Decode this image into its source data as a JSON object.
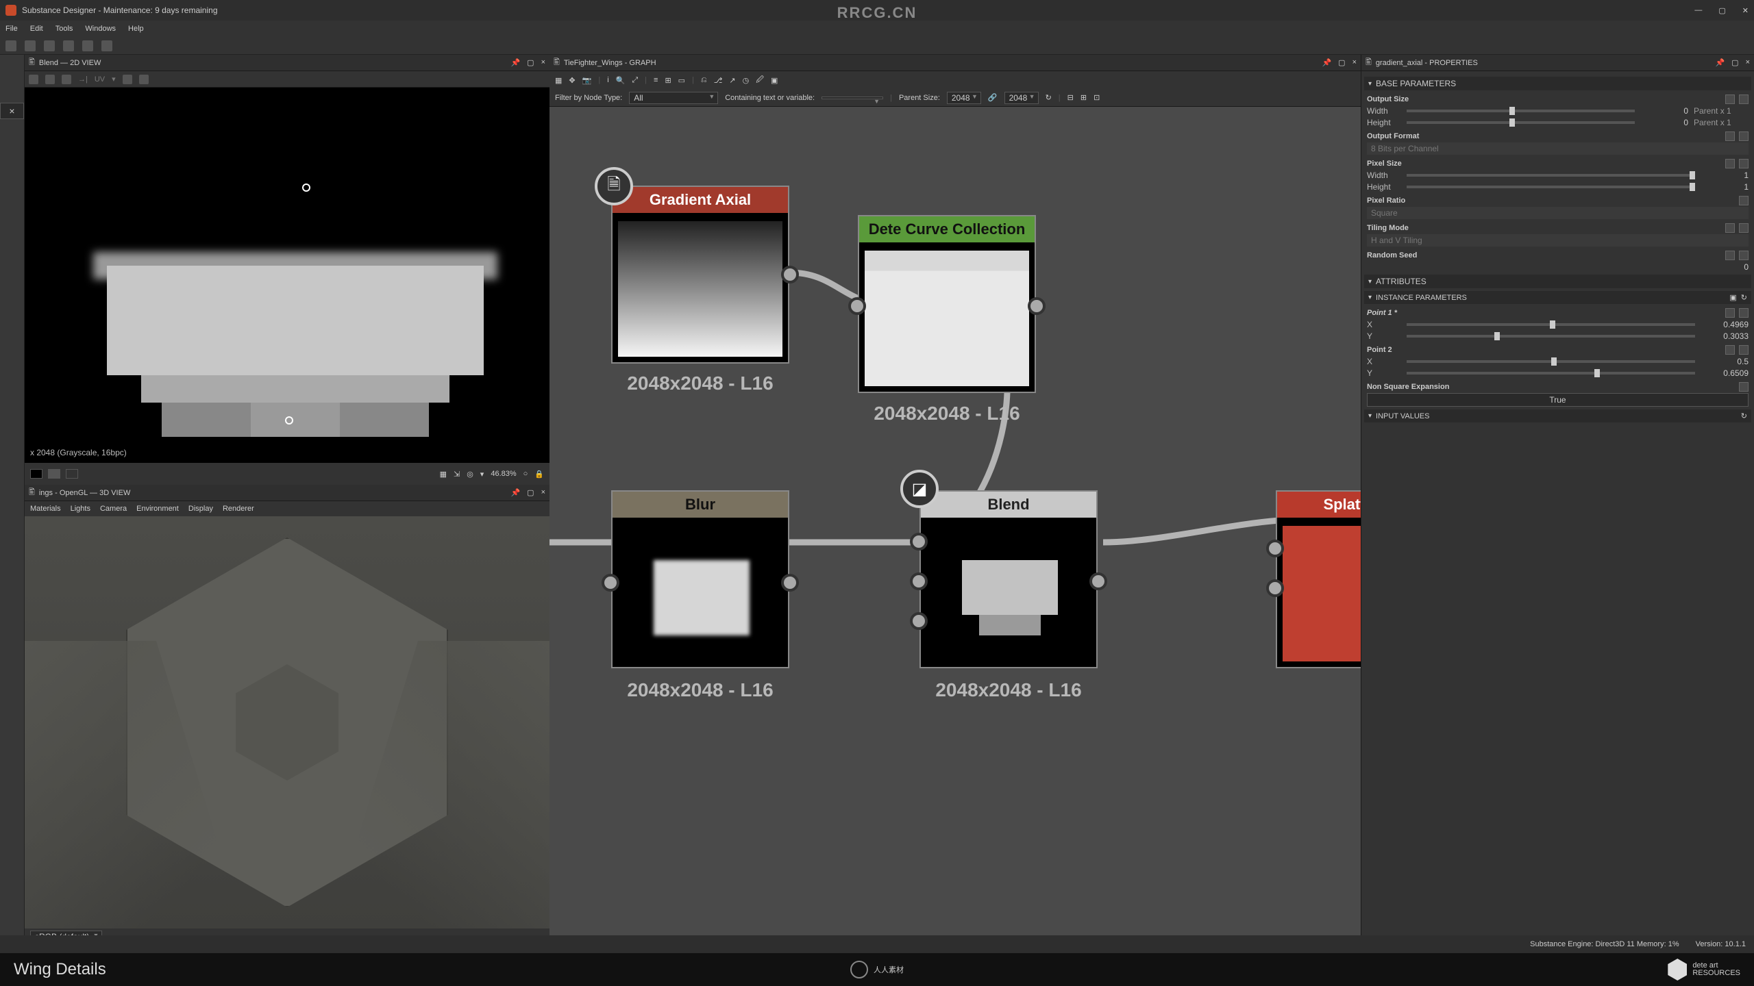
{
  "app": {
    "title": "Substance Designer - Maintenance: 9 days remaining",
    "menu": [
      "File",
      "Edit",
      "Tools",
      "Windows",
      "Help"
    ]
  },
  "center_watermark": "RRCG.CN",
  "panel2d": {
    "title": "Blend — 2D VIEW",
    "status": "x 2048 (Grayscale, 16bpc)",
    "zoom": "46.83%"
  },
  "panel3d": {
    "title": "ings - OpenGL — 3D VIEW",
    "menu": [
      "Materials",
      "Lights",
      "Camera",
      "Environment",
      "Display",
      "Renderer"
    ],
    "colorspace": "sRGB (default)"
  },
  "graph": {
    "title": "TieFighter_Wings - GRAPH",
    "filterLabel": "Filter by Node Type:",
    "filterValue": "All",
    "containLabel": "Containing text or variable:",
    "parentSizeLabel": "Parent Size:",
    "parentSize1": "2048",
    "parentSize2": "2048",
    "nodes": {
      "gradient": {
        "label": "Gradient Axial",
        "res": "2048x2048 - L16"
      },
      "curve": {
        "label": "Dete Curve Collection",
        "res": "2048x2048 - L16"
      },
      "blur": {
        "label": "Blur",
        "res": "2048x2048 - L16"
      },
      "blend": {
        "label": "Blend",
        "res": "2048x2048 - L16"
      },
      "splatt": {
        "label": "Splatt"
      }
    }
  },
  "props": {
    "title": "gradient_axial - PROPERTIES",
    "sections": {
      "base": "BASE PARAMETERS",
      "attr": "ATTRIBUTES",
      "inst": "INSTANCE PARAMETERS",
      "inpv": "INPUT VALUES"
    },
    "outputSize": {
      "label": "Output Size",
      "width_label": "Width",
      "height_label": "Height",
      "width": "0",
      "height": "0",
      "wparent": "Parent x 1",
      "hparent": "Parent x 1"
    },
    "outputFormat": {
      "label": "Output Format",
      "value": "8 Bits per Channel"
    },
    "pixelSize": {
      "label": "Pixel Size",
      "width_label": "Width",
      "height_label": "Height",
      "width": "1",
      "height": "1"
    },
    "pixelRatio": {
      "label": "Pixel Ratio",
      "value": "Square"
    },
    "tilingMode": {
      "label": "Tiling Mode",
      "value": "H and V Tiling"
    },
    "randomSeed": {
      "label": "Random Seed",
      "value": "0"
    },
    "point1": {
      "label": "Point 1 *",
      "x_label": "X",
      "y_label": "Y",
      "x": "0.4969",
      "y": "0.3033"
    },
    "point2": {
      "label": "Point 2",
      "x_label": "X",
      "y_label": "Y",
      "x": "0.5",
      "y": "0.6509"
    },
    "nse": {
      "label": "Non Square Expansion",
      "value": "True"
    }
  },
  "status": {
    "engine": "Substance Engine: Direct3D 11  Memory: 1%",
    "version": "Version: 10.1.1"
  },
  "footer": {
    "title": "Wing Details",
    "center": "人人素材",
    "brand": "dete art\nRESOURCES"
  },
  "chart_data": null
}
